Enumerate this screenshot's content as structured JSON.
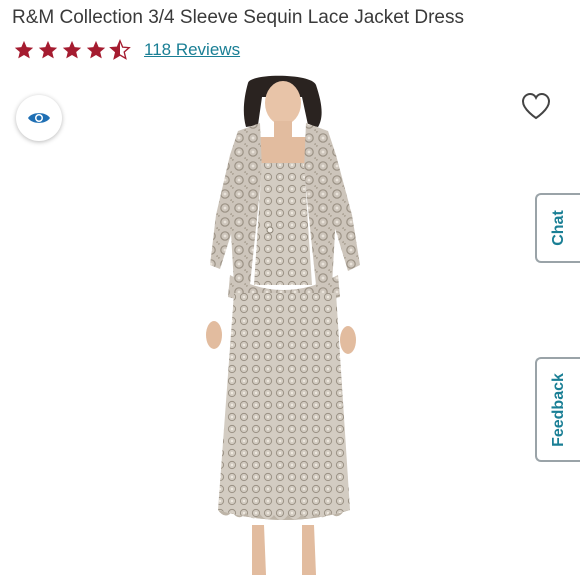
{
  "product": {
    "title": "R&M Collection 3/4 Sleeve Sequin Lace Jacket Dress",
    "rating_stars": 4.5,
    "reviews_label": "118 Reviews"
  },
  "side_tabs": {
    "chat": "Chat",
    "feedback": "Feedback"
  },
  "icons": {
    "view": "eye-icon",
    "favorite": "heart-icon",
    "rating": "star-icon"
  },
  "colors": {
    "star": "#a51c30",
    "link": "#1a7f95",
    "tab_text": "#1a7f95"
  }
}
